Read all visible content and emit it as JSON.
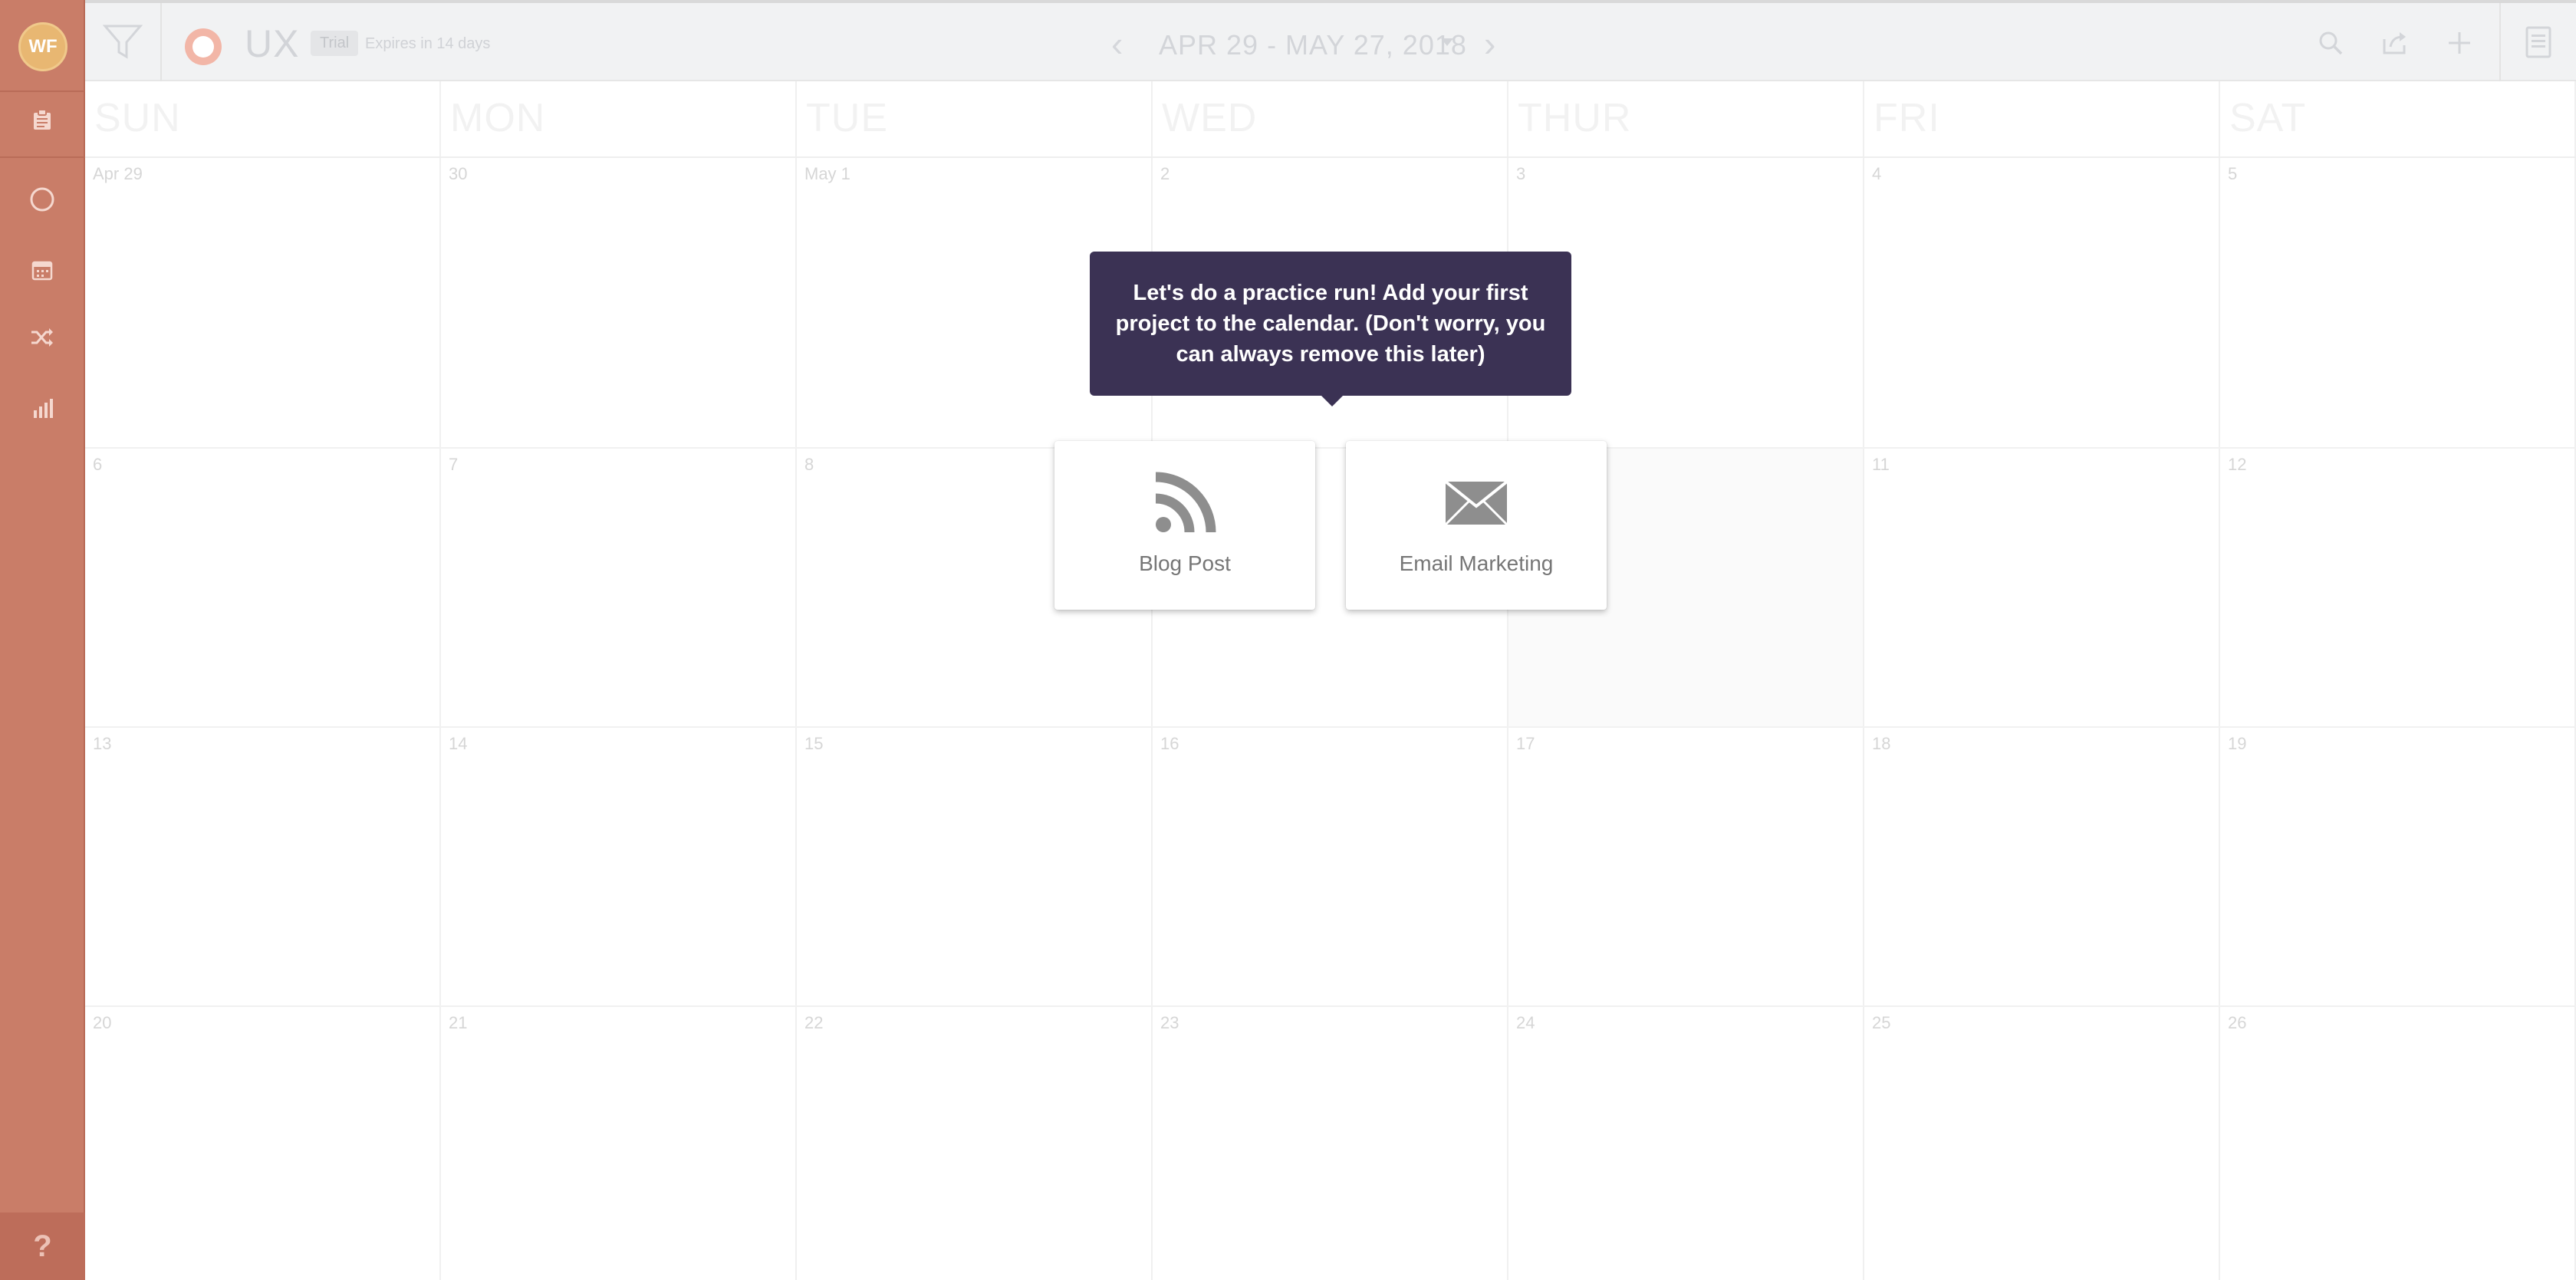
{
  "sidebar": {
    "avatar_initials": "WF",
    "nav_items": [
      {
        "name": "clipboard-icon"
      },
      {
        "name": "circle-icon"
      },
      {
        "name": "calendar-icon"
      },
      {
        "name": "shuffle-icon"
      },
      {
        "name": "bar-chart-icon"
      }
    ],
    "help_label": "?",
    "color": "#c97d68"
  },
  "header": {
    "project_name": "UX",
    "trial_badge": "Trial",
    "expires_text": "Expires in 14 days",
    "date_range": "APR 29 - MAY 27, 2018",
    "prev_label": "‹",
    "next_label": "›"
  },
  "calendar": {
    "day_headers": [
      "SUN",
      "MON",
      "TUE",
      "WED",
      "THUR",
      "FRI",
      "SAT"
    ],
    "weeks": [
      [
        "Apr 29",
        "30",
        "May 1",
        "2",
        "3",
        "4",
        "5"
      ],
      [
        "6",
        "7",
        "8",
        "",
        "",
        "11",
        "12"
      ],
      [
        "13",
        "14",
        "15",
        "16",
        "17",
        "18",
        "19"
      ],
      [
        "20",
        "21",
        "22",
        "23",
        "24",
        "25",
        "26"
      ]
    ]
  },
  "onboarding": {
    "tooltip_text": "Let's do a practice run! Add your first project to the calendar. (Don't worry, you can always remove this later)",
    "tooltip_color": "#3b3254",
    "options": [
      {
        "label": "Blog Post",
        "icon": "rss-icon"
      },
      {
        "label": "Email Marketing",
        "icon": "envelope-icon"
      }
    ]
  }
}
